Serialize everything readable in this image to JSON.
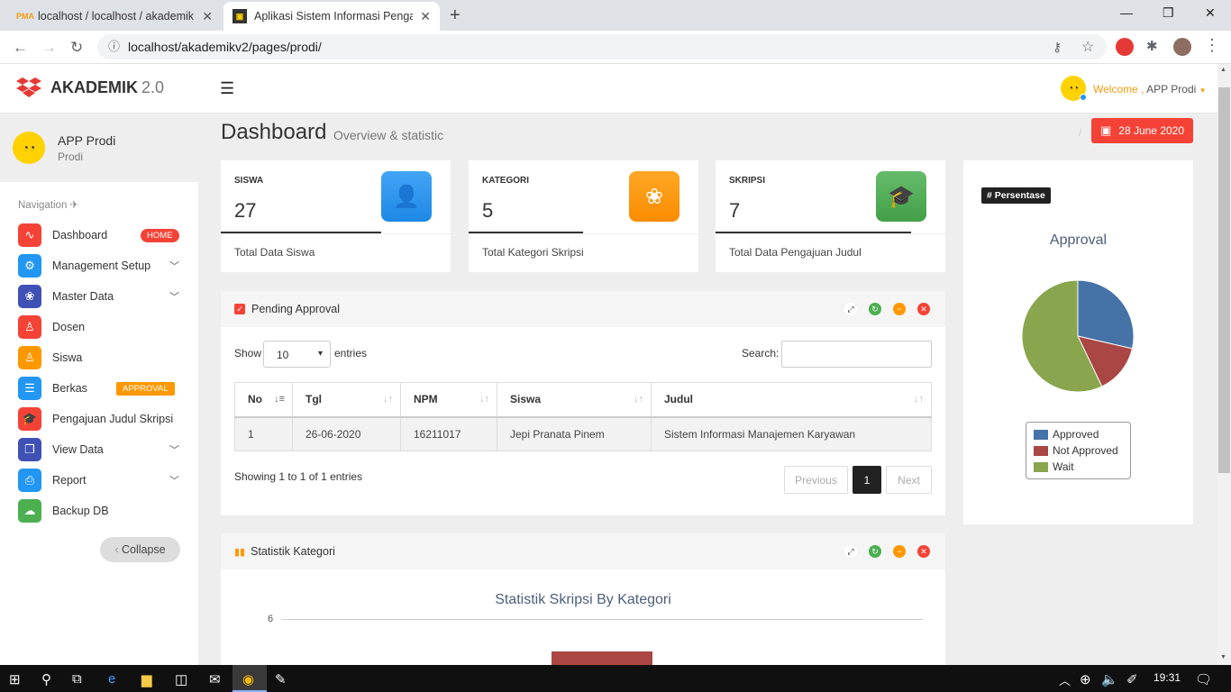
{
  "browser": {
    "tabs": [
      {
        "title": "localhost / localhost / akademik / ",
        "favicon": "phpmyadmin-icon"
      },
      {
        "title": "Aplikasi Sistem Informasi Pengaju",
        "favicon": "app-icon"
      }
    ],
    "url": "localhost/akademikv2/pages/prodi/"
  },
  "header": {
    "logo_text": "AKADEMIK",
    "logo_version": "2.0",
    "welcome_prefix": "Welcome ,",
    "welcome_user": "APP Prodi"
  },
  "sidebar": {
    "user_name": "APP Prodi",
    "user_role": "Prodi",
    "nav_label": "Navigation",
    "items": [
      {
        "label": "Dashboard",
        "badge": "HOME",
        "color": "#f44336"
      },
      {
        "label": "Management Setup",
        "color": "#2196f3"
      },
      {
        "label": "Master Data",
        "color": "#3f51b5"
      },
      {
        "label": "Dosen",
        "color": "#f44336"
      },
      {
        "label": "Siswa",
        "color": "#ff9800"
      },
      {
        "label": "Berkas",
        "badge": "APPROVAL",
        "color": "#2196f3"
      },
      {
        "label": "Pengajuan Judul Skripsi",
        "color": "#f44336"
      },
      {
        "label": "View Data",
        "color": "#3f51b5"
      },
      {
        "label": "Report",
        "color": "#2196f3"
      },
      {
        "label": "Backup DB",
        "color": "#4caf50"
      }
    ],
    "collapse_label": "Collapse"
  },
  "page": {
    "title": "Dashboard",
    "subtitle": "Overview & statistic",
    "date": "28 June 2020"
  },
  "stats": [
    {
      "label": "SISWA",
      "value": "27",
      "desc": "Total Data Siswa",
      "color": "#1e88e5"
    },
    {
      "label": "KATEGORI",
      "value": "5",
      "desc": "Total Kategori Skripsi",
      "color": "#fb8c00"
    },
    {
      "label": "SKRIPSI",
      "value": "7",
      "desc": "Total Data Pengajuan Judul",
      "color": "#43a047"
    }
  ],
  "pending": {
    "title": "Pending Approval",
    "show_label": "Show",
    "entries_value": "10",
    "entries_label": "entries",
    "search_label": "Search:",
    "columns": [
      "No",
      "Tgl",
      "NPM",
      "Siswa",
      "Judul"
    ],
    "rows": [
      [
        "1",
        "26-06-2020",
        "16211017",
        "Jepi Pranata Pinem",
        "Sistem Informasi Manajemen Karyawan"
      ]
    ],
    "info": "Showing 1 to 1 of 1 entries",
    "prev": "Previous",
    "page": "1",
    "next": "Next"
  },
  "statistik": {
    "title": "Statistik Kategori"
  },
  "chart_data": [
    {
      "type": "pie",
      "title": "Approval",
      "tag": "# Persentase",
      "categories": [
        "Approved",
        "Not Approved",
        "Wait"
      ],
      "values": [
        28.6,
        14.3,
        57.1
      ],
      "colors": [
        "#4572a7",
        "#aa4643",
        "#89a54e"
      ],
      "legend": "bottom"
    },
    {
      "type": "bar",
      "title": "Statistik Skripsi By Kategori",
      "ytick_visible": "6",
      "ylim": [
        0,
        6
      ],
      "values": [
        5.5
      ],
      "colors": [
        "#aa4643"
      ]
    }
  ],
  "taskbar": {
    "time": "19:31"
  }
}
